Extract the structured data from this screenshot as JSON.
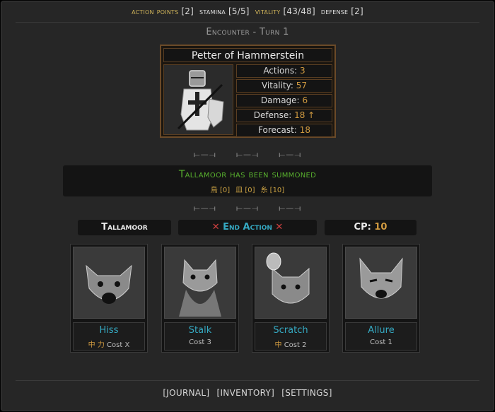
{
  "stats_bar": {
    "ap_label": "action points",
    "ap_value": "[2]",
    "stamina_label": "stamina",
    "stamina_value": "[5/5]",
    "vitality_label": "vitality",
    "vitality_value": "[43/48]",
    "defense_label": "defense",
    "defense_value": "[2]"
  },
  "encounter": "Encounter - Turn 1",
  "enemy": {
    "name": "Petter of Hammerstein",
    "stats": [
      {
        "label": "Actions:",
        "value": "3"
      },
      {
        "label": "Vitality:",
        "value": "57"
      },
      {
        "label": "Damage:",
        "value": "6"
      },
      {
        "label": "Defense:",
        "value": "18 ↑"
      },
      {
        "label": "Forecast:",
        "value": "18"
      }
    ]
  },
  "divider_glyph": "⟝—⟞",
  "message": {
    "title": "Tallamoor has been summoned",
    "resources": [
      "鳥 [0]",
      "皿 [0]",
      "糸 [10]"
    ]
  },
  "controls": {
    "creature_name": "Tallamoor",
    "end_action": "End Action",
    "cp_label": "CP:",
    "cp_value": "10"
  },
  "cards": [
    {
      "name": "Hiss",
      "glyphs": "中 力",
      "cost": "Cost X"
    },
    {
      "name": "Stalk",
      "glyphs": "",
      "cost": "Cost 3"
    },
    {
      "name": "Scratch",
      "glyphs": "中",
      "cost": "Cost 2"
    },
    {
      "name": "Allure",
      "glyphs": "",
      "cost": "Cost 1"
    }
  ],
  "footer": {
    "journal": "[JOURNAL]",
    "inventory": "[INVENTORY]",
    "settings": "[SETTINGS]"
  }
}
